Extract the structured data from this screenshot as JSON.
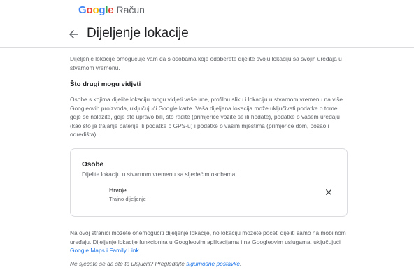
{
  "brand": {
    "google_letters": [
      {
        "char": "G",
        "color": "#4285F4"
      },
      {
        "char": "o",
        "color": "#EA4335"
      },
      {
        "char": "o",
        "color": "#FBBC05"
      },
      {
        "char": "g",
        "color": "#4285F4"
      },
      {
        "char": "l",
        "color": "#34A853"
      },
      {
        "char": "e",
        "color": "#EA4335"
      }
    ],
    "product": "Račun"
  },
  "header": {
    "back_icon": "arrow-back-icon",
    "title": "Dijeljenje lokacije"
  },
  "intro": "Dijeljenje lokacije omogućuje vam da s osobama koje odaberete dijelite svoju lokaciju sa svojih uređaja u stvarnom vremenu.",
  "section": {
    "heading": "Što drugi mogu vidjeti",
    "body": "Osobe s kojima dijelite lokaciju mogu vidjeti vaše ime, profilnu sliku i lokaciju u stvarnom vremenu na više Googleovih proizvoda, uključujući Google karte. Vaša dijeljena lokacija može uključivati podatke o tome gdje se nalazite, gdje ste upravo bili, što radite (primjerice vozite se ili hodate), podatke o vašem uređaju (kao što je trajanje baterije ili podatke o GPS-u) i podatke o vašim mjestima (primjerice dom, posao i odredišta)."
  },
  "card": {
    "title": "Osobe",
    "subtitle": "Dijelite lokaciju u stvarnom vremenu sa sljedećim osobama:",
    "person": {
      "name": "Hrvoje",
      "status": "Trajno dijeljenje",
      "remove_icon": "close-icon"
    }
  },
  "footer": {
    "text_before": "Na ovoj stranici možete onemogućiti dijeljenje lokacije, no lokaciju možete početi dijeliti samo na mobilnom uređaju. Dijeljenje lokacije funkcionira u Googleovim aplikacijama i na Googleovim uslugama, uključujući ",
    "link": "Google Maps i Family Link",
    "text_after": "."
  },
  "hint": {
    "text": "Ne sjećate se da ste to uključili? Pregledajte ",
    "link": "sigurnosne postavke",
    "text_after": "."
  },
  "colors": {
    "link": "#1a73e8",
    "secondary_text": "#5f6368",
    "divider": "#dadce0"
  }
}
